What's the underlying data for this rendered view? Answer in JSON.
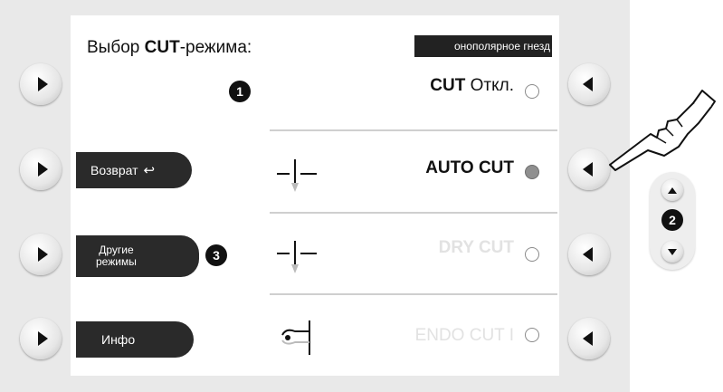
{
  "title": {
    "prefix": "Выбор ",
    "bold": "CUT",
    "suffix": "-режима:"
  },
  "socket_tag": "онополярное гнезд",
  "callouts": [
    "1",
    "2",
    "3"
  ],
  "modes": [
    {
      "bold": "CUT",
      "light": " Откл.",
      "state": "unselected"
    },
    {
      "label": "AUTO CUT",
      "state": "selected"
    },
    {
      "label": "DRY CUT",
      "state": "unselected"
    },
    {
      "label": "ENDO CUT I",
      "state": "unselected"
    }
  ],
  "left_tabs": {
    "back": "Возврат",
    "back_icon": "↩",
    "other_line1": "Другие",
    "other_line2": "режимы",
    "info": "Инфо"
  },
  "icons": {
    "side_left": "play-right-icon",
    "side_right": "play-left-icon",
    "electrode": "electrode-icon",
    "hand": "pointing-hand-icon"
  },
  "colors": {
    "frame": "#e9e9e9",
    "tab": "#2a2a2a",
    "selected_radio": "#8f8f8f",
    "faded_text": "#e2e2e2"
  }
}
